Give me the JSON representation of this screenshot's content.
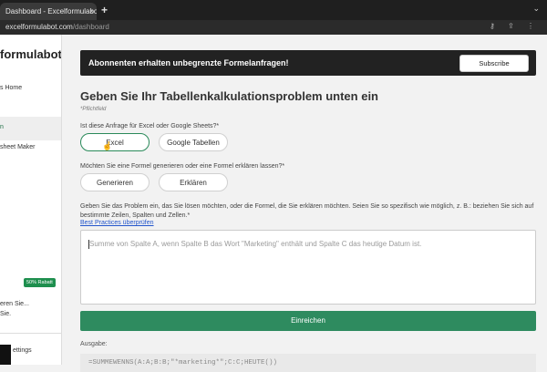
{
  "browser": {
    "tab_title": "Dashboard - Excelformulabot.c",
    "tab_close": "×",
    "new_tab": "+",
    "tab_menu": "⌄",
    "url_host": "excelformulabot.com",
    "url_path": "/dashboard",
    "addr_icons": "⚷ ⇪ ⋮"
  },
  "sidebar": {
    "logo": "formulabot",
    "home": "s Home",
    "active_item": "n",
    "sheet_maker": "sheet Maker",
    "discount_badge": "50% Rabatt",
    "item_partial": "eren Sie...",
    "item_partial2": "Sie.",
    "settings": "ettings"
  },
  "banner": {
    "text": "Abonnenten erhalten unbegrenzte Formelanfragen!",
    "subscribe": "Subscribe"
  },
  "main": {
    "title": "Geben Sie Ihr Tabellenkalkulationsproblem unten ein",
    "required": "*Pflichtfeld",
    "q1": "Ist diese Anfrage für Excel oder Google Sheets?*",
    "opt_excel": "Excel",
    "opt_google": "Google Tabellen",
    "q2": "Möchten Sie eine Formel generieren oder eine Formel erklären lassen?*",
    "opt_generate": "Generieren",
    "opt_explain": "Erklären",
    "q3": "Geben Sie das Problem ein, das Sie lösen möchten, oder die Formel, die Sie erklären möchten. Seien Sie so spezifisch wie möglich, z. B.: beziehen Sie sich auf bestimmte Zeilen, Spalten und Zellen.*",
    "best_practices": "Best Practices überprüfen",
    "placeholder": "Summe von Spalte A, wenn Spalte B das Wort \"Marketing\" enthält und Spalte C das heutige Datum ist.",
    "submit": "Einreichen",
    "output_label": "Ausgabe:",
    "output_value": "=SUMMEWENNS(A:A;B:B;\"*marketing*\";C:C;HEUTE())"
  }
}
